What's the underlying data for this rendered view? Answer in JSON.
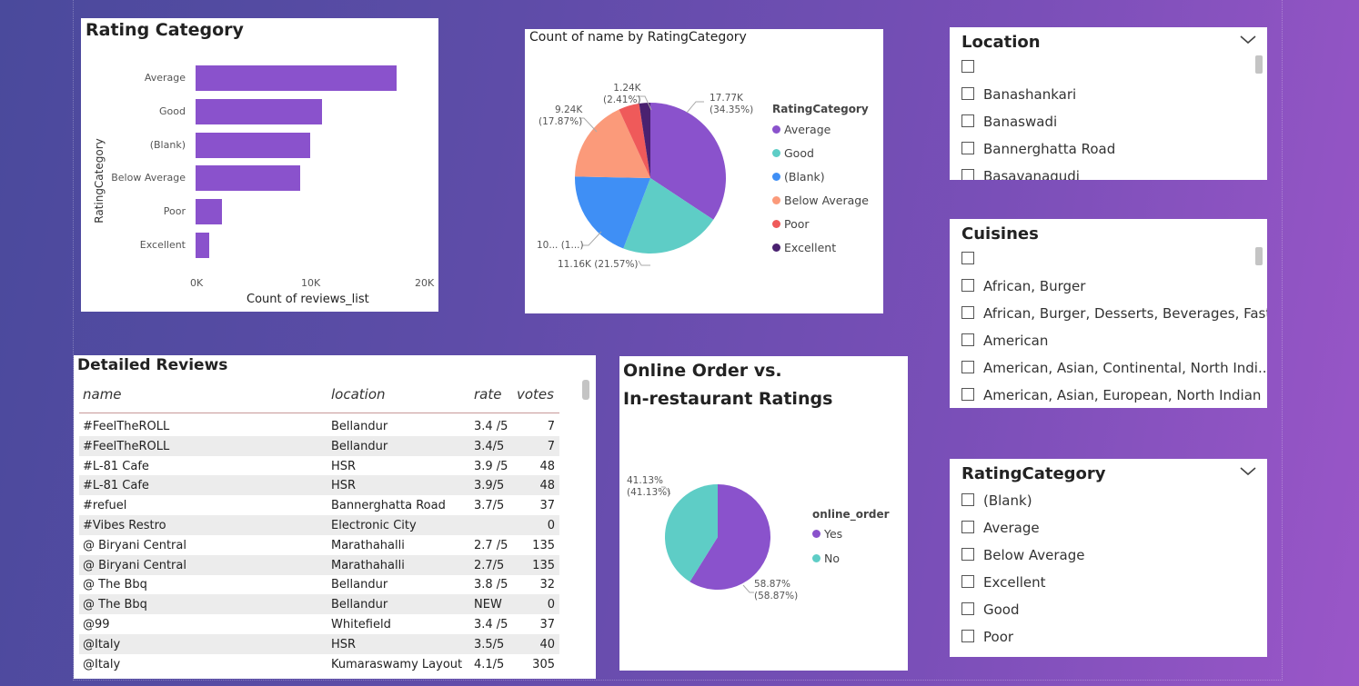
{
  "rating_chart": {
    "title": "Rating Category",
    "chart_data": {
      "type": "bar",
      "orientation": "horizontal",
      "categories": [
        "Average",
        "Good",
        "(Blank)",
        "Below Average",
        "Poor",
        "Excellent"
      ],
      "values": [
        17770,
        11160,
        10100,
        9240,
        2300,
        1240
      ],
      "xlabel": "Count of reviews_list",
      "ylabel": "RatingCategory",
      "xticks": [
        "0K",
        "10K",
        "20K"
      ],
      "xlim": [
        0,
        20000
      ]
    }
  },
  "pie_rating": {
    "title": "Count of name by RatingCategory",
    "legend_title": "RatingCategory",
    "labels": {
      "average": [
        "17.77K",
        "(34.35%)"
      ],
      "good": [
        "11.16K (21.57%)"
      ],
      "blank": [
        "10... (1...)"
      ],
      "below_average": [
        "9.24K",
        "(17.87%)"
      ],
      "poor": [
        "1.24K",
        "(2.41%)"
      ]
    },
    "chart_data": {
      "type": "pie",
      "categories": [
        "Average",
        "Good",
        "(Blank)",
        "Below Average",
        "Poor",
        "Excellent"
      ],
      "values": [
        17770,
        11160,
        10100,
        9240,
        2300,
        1240
      ],
      "colors": [
        "#8a52cc",
        "#5ecdc6",
        "#3f8ff5",
        "#fb9a7a",
        "#ef5a5a",
        "#4a2170"
      ]
    }
  },
  "table": {
    "title": "Detailed Reviews",
    "headers": {
      "name": "name",
      "location": "location",
      "rate": "rate",
      "votes": "votes"
    },
    "rows": [
      {
        "name": "#FeelTheROLL",
        "location": "Bellandur",
        "rate": "3.4 /5",
        "votes": "7"
      },
      {
        "name": "#FeelTheROLL",
        "location": "Bellandur",
        "rate": "3.4/5",
        "votes": "7"
      },
      {
        "name": "#L-81 Cafe",
        "location": "HSR",
        "rate": "3.9 /5",
        "votes": "48"
      },
      {
        "name": "#L-81 Cafe",
        "location": "HSR",
        "rate": "3.9/5",
        "votes": "48"
      },
      {
        "name": "#refuel",
        "location": "Bannerghatta Road",
        "rate": "3.7/5",
        "votes": "37"
      },
      {
        "name": "#Vibes Restro",
        "location": "Electronic City",
        "rate": "",
        "votes": "0"
      },
      {
        "name": "@ Biryani Central",
        "location": "Marathahalli",
        "rate": "2.7 /5",
        "votes": "135"
      },
      {
        "name": "@ Biryani Central",
        "location": "Marathahalli",
        "rate": "2.7/5",
        "votes": "135"
      },
      {
        "name": "@ The Bbq",
        "location": "Bellandur",
        "rate": "3.8 /5",
        "votes": "32"
      },
      {
        "name": "@ The Bbq",
        "location": "Bellandur",
        "rate": "NEW",
        "votes": "0"
      },
      {
        "name": "@99",
        "location": "Whitefield",
        "rate": "3.4 /5",
        "votes": "37"
      },
      {
        "name": "@Italy",
        "location": "HSR",
        "rate": "3.5/5",
        "votes": "40"
      },
      {
        "name": "@Italy",
        "location": "Kumaraswamy Layout",
        "rate": "4.1/5",
        "votes": "305"
      }
    ]
  },
  "pie_online": {
    "title_line1": "Online Order vs.",
    "title_line2": "In-restaurant Ratings",
    "legend_title": "online_order",
    "labels": {
      "yes": [
        "58.87%",
        "(58.87%)"
      ],
      "no": [
        "41.13%",
        "(41.13%)"
      ]
    },
    "chart_data": {
      "type": "pie",
      "categories": [
        "Yes",
        "No"
      ],
      "values": [
        58.87,
        41.13
      ],
      "colors": [
        "#8a52cc",
        "#5ecdc6"
      ]
    }
  },
  "slicer_location": {
    "title": "Location",
    "items": [
      "",
      "Banashankari",
      "Banaswadi",
      "Bannerghatta Road",
      "Basavanagudi"
    ]
  },
  "slicer_cuisines": {
    "title": "Cuisines",
    "items": [
      "",
      "African, Burger",
      "African, Burger, Desserts, Beverages, Fast ...",
      "American",
      "American, Asian, Continental, North Indi...",
      "American, Asian, European, North Indian"
    ]
  },
  "slicer_rating": {
    "title": "RatingCategory",
    "items": [
      "(Blank)",
      "Average",
      "Below Average",
      "Excellent",
      "Good",
      "Poor"
    ]
  },
  "icons": {
    "dropdown": "chevron-down-icon",
    "checkbox": "checkbox-icon"
  }
}
